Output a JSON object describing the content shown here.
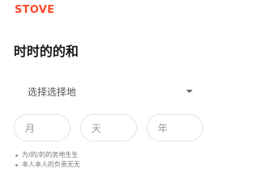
{
  "brand": {
    "logo_text": "STOVE",
    "accent_color": "#ff4b2b"
  },
  "page": {
    "title": "时时的的和"
  },
  "region": {
    "placeholder": "选择选择地",
    "icon": "caret-down-icon"
  },
  "birthdate": {
    "month_placeholder": "月",
    "day_placeholder": "天",
    "year_placeholder": "年"
  },
  "notes": [
    "为/的/的的务地生生",
    "本人本人的负责无无"
  ]
}
